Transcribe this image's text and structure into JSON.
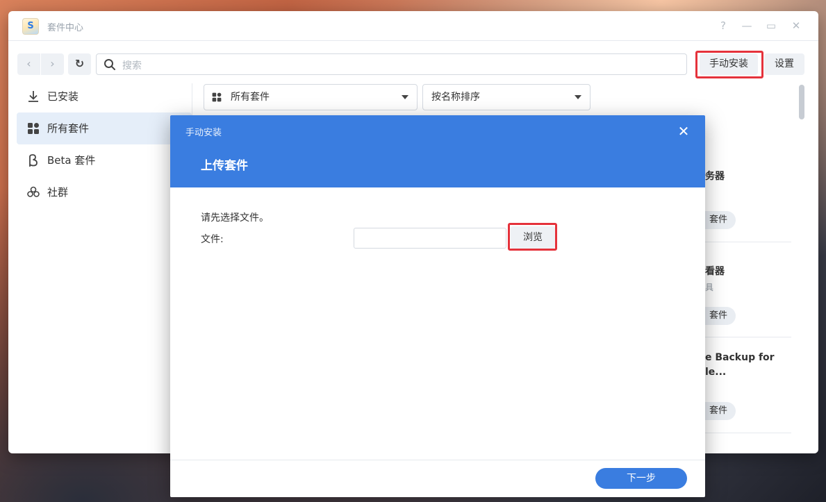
{
  "window": {
    "title": "套件中心",
    "app_icon_letter": "S",
    "controls": {
      "help": "?",
      "minimize": "—",
      "maximize": "▭",
      "close": "✕"
    }
  },
  "toolbar": {
    "back": "‹",
    "forward": "›",
    "refresh": "↻",
    "search_placeholder": "搜索",
    "manual_install": "手动安装",
    "settings": "设置"
  },
  "sidebar": {
    "items": [
      {
        "label": "已安装",
        "icon": "download-icon",
        "active": false
      },
      {
        "label": "所有套件",
        "icon": "grid-icon",
        "active": true
      },
      {
        "label": "Beta 套件",
        "icon": "beta-icon",
        "active": false
      },
      {
        "label": "社群",
        "icon": "community-icon",
        "active": false
      }
    ]
  },
  "filters": {
    "category": "所有套件",
    "sort": "按名称排序"
  },
  "cards": [
    {
      "name": "务器",
      "sub": "",
      "pill": "套件"
    },
    {
      "name": "看器",
      "sub": "具",
      "pill": "套件"
    },
    {
      "name": "e Backup for",
      "name2": "le...",
      "sub": "",
      "pill": "套件"
    }
  ],
  "dialog": {
    "caption": "手动安装",
    "heading": "上传套件",
    "close": "✕",
    "hint": "请先选择文件。",
    "file_label": "文件:",
    "file_value": "",
    "browse": "浏览",
    "next": "下一步"
  },
  "colors": {
    "accent": "#3a7de0",
    "highlight": "#e5323b",
    "active_bg": "#e5eef9"
  }
}
